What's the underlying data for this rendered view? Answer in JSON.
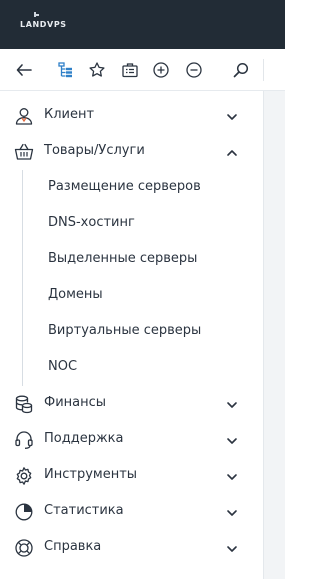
{
  "brand": {
    "logo_text": "LANDVPS"
  },
  "toolbar": {
    "buttons": [
      {
        "name": "back-button",
        "icon": "back-arrow-icon"
      },
      {
        "name": "tree-view-button",
        "icon": "tree-icon"
      },
      {
        "name": "favorites-button",
        "icon": "star-icon"
      },
      {
        "name": "tasks-button",
        "icon": "briefcase-icon"
      },
      {
        "name": "expand-all-button",
        "icon": "plus-circle-icon"
      },
      {
        "name": "collapse-all-button",
        "icon": "minus-circle-icon"
      },
      {
        "name": "search-button",
        "icon": "search-icon"
      }
    ],
    "accent": "#2f80c8"
  },
  "menu": {
    "items": [
      {
        "label": "Клиент",
        "icon": "user-icon",
        "expanded": false
      },
      {
        "label": "Товары/Услуги",
        "icon": "basket-icon",
        "expanded": true,
        "children": [
          {
            "label": "Размещение серверов"
          },
          {
            "label": "DNS-хостинг"
          },
          {
            "label": "Выделенные серверы"
          },
          {
            "label": "Домены"
          },
          {
            "label": "Виртуальные серверы"
          },
          {
            "label": "NOC"
          }
        ]
      },
      {
        "label": "Финансы",
        "icon": "coins-icon",
        "expanded": false
      },
      {
        "label": "Поддержка",
        "icon": "headset-icon",
        "expanded": false
      },
      {
        "label": "Инструменты",
        "icon": "gear-icon",
        "expanded": false
      },
      {
        "label": "Статистика",
        "icon": "pie-chart-icon",
        "expanded": false
      },
      {
        "label": "Справка",
        "icon": "lifebuoy-icon",
        "expanded": false
      }
    ]
  },
  "colors": {
    "topbar": "#222c36",
    "text": "#2b3440",
    "icon": "#2b3440"
  }
}
